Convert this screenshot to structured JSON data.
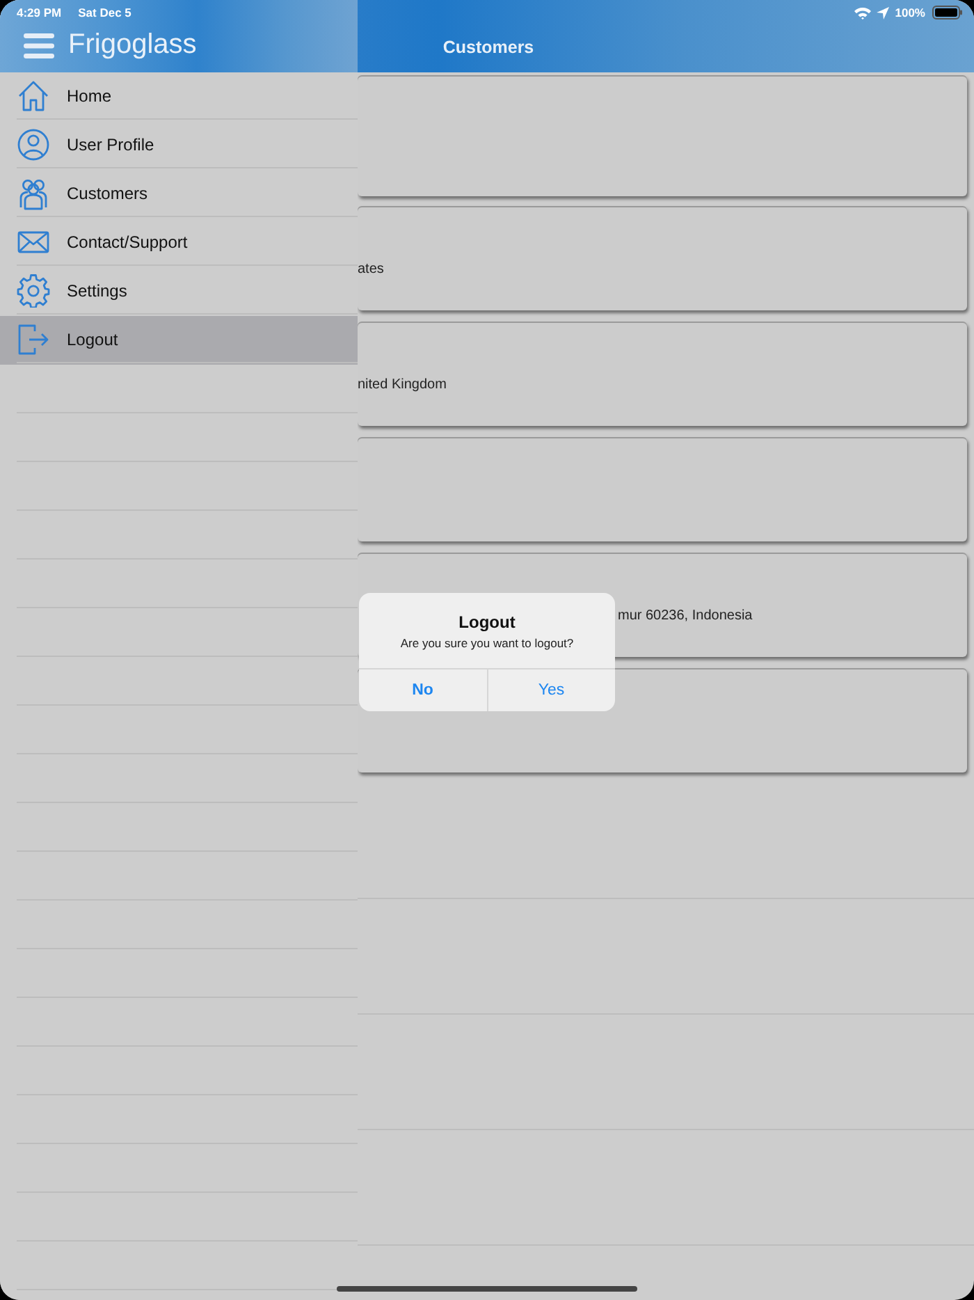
{
  "status_bar": {
    "time": "4:29 PM",
    "date": "Sat Dec 5",
    "battery": "100%"
  },
  "header": {
    "title": "Customers"
  },
  "cards": [
    {
      "kind": "blank"
    },
    {
      "kind": "text",
      "text": "ates"
    },
    {
      "kind": "text",
      "text": "nited Kingdom"
    },
    {
      "kind": "blank"
    },
    {
      "kind": "text",
      "text": "mur 60236, Indonesia"
    },
    {
      "kind": "blank"
    }
  ],
  "drawer": {
    "title": "Frigoglass",
    "items": [
      {
        "label": "Home",
        "selected": false
      },
      {
        "label": "User Profile",
        "selected": false
      },
      {
        "label": "Customers",
        "selected": false
      },
      {
        "label": "Contact/Support",
        "selected": false
      },
      {
        "label": "Settings",
        "selected": false
      },
      {
        "label": "Logout",
        "selected": true
      }
    ]
  },
  "dialog": {
    "title": "Logout",
    "message": "Are you sure you want to logout?",
    "buttons": [
      {
        "label": "No",
        "kind": "default"
      },
      {
        "label": "Yes",
        "kind": "normal"
      }
    ]
  }
}
